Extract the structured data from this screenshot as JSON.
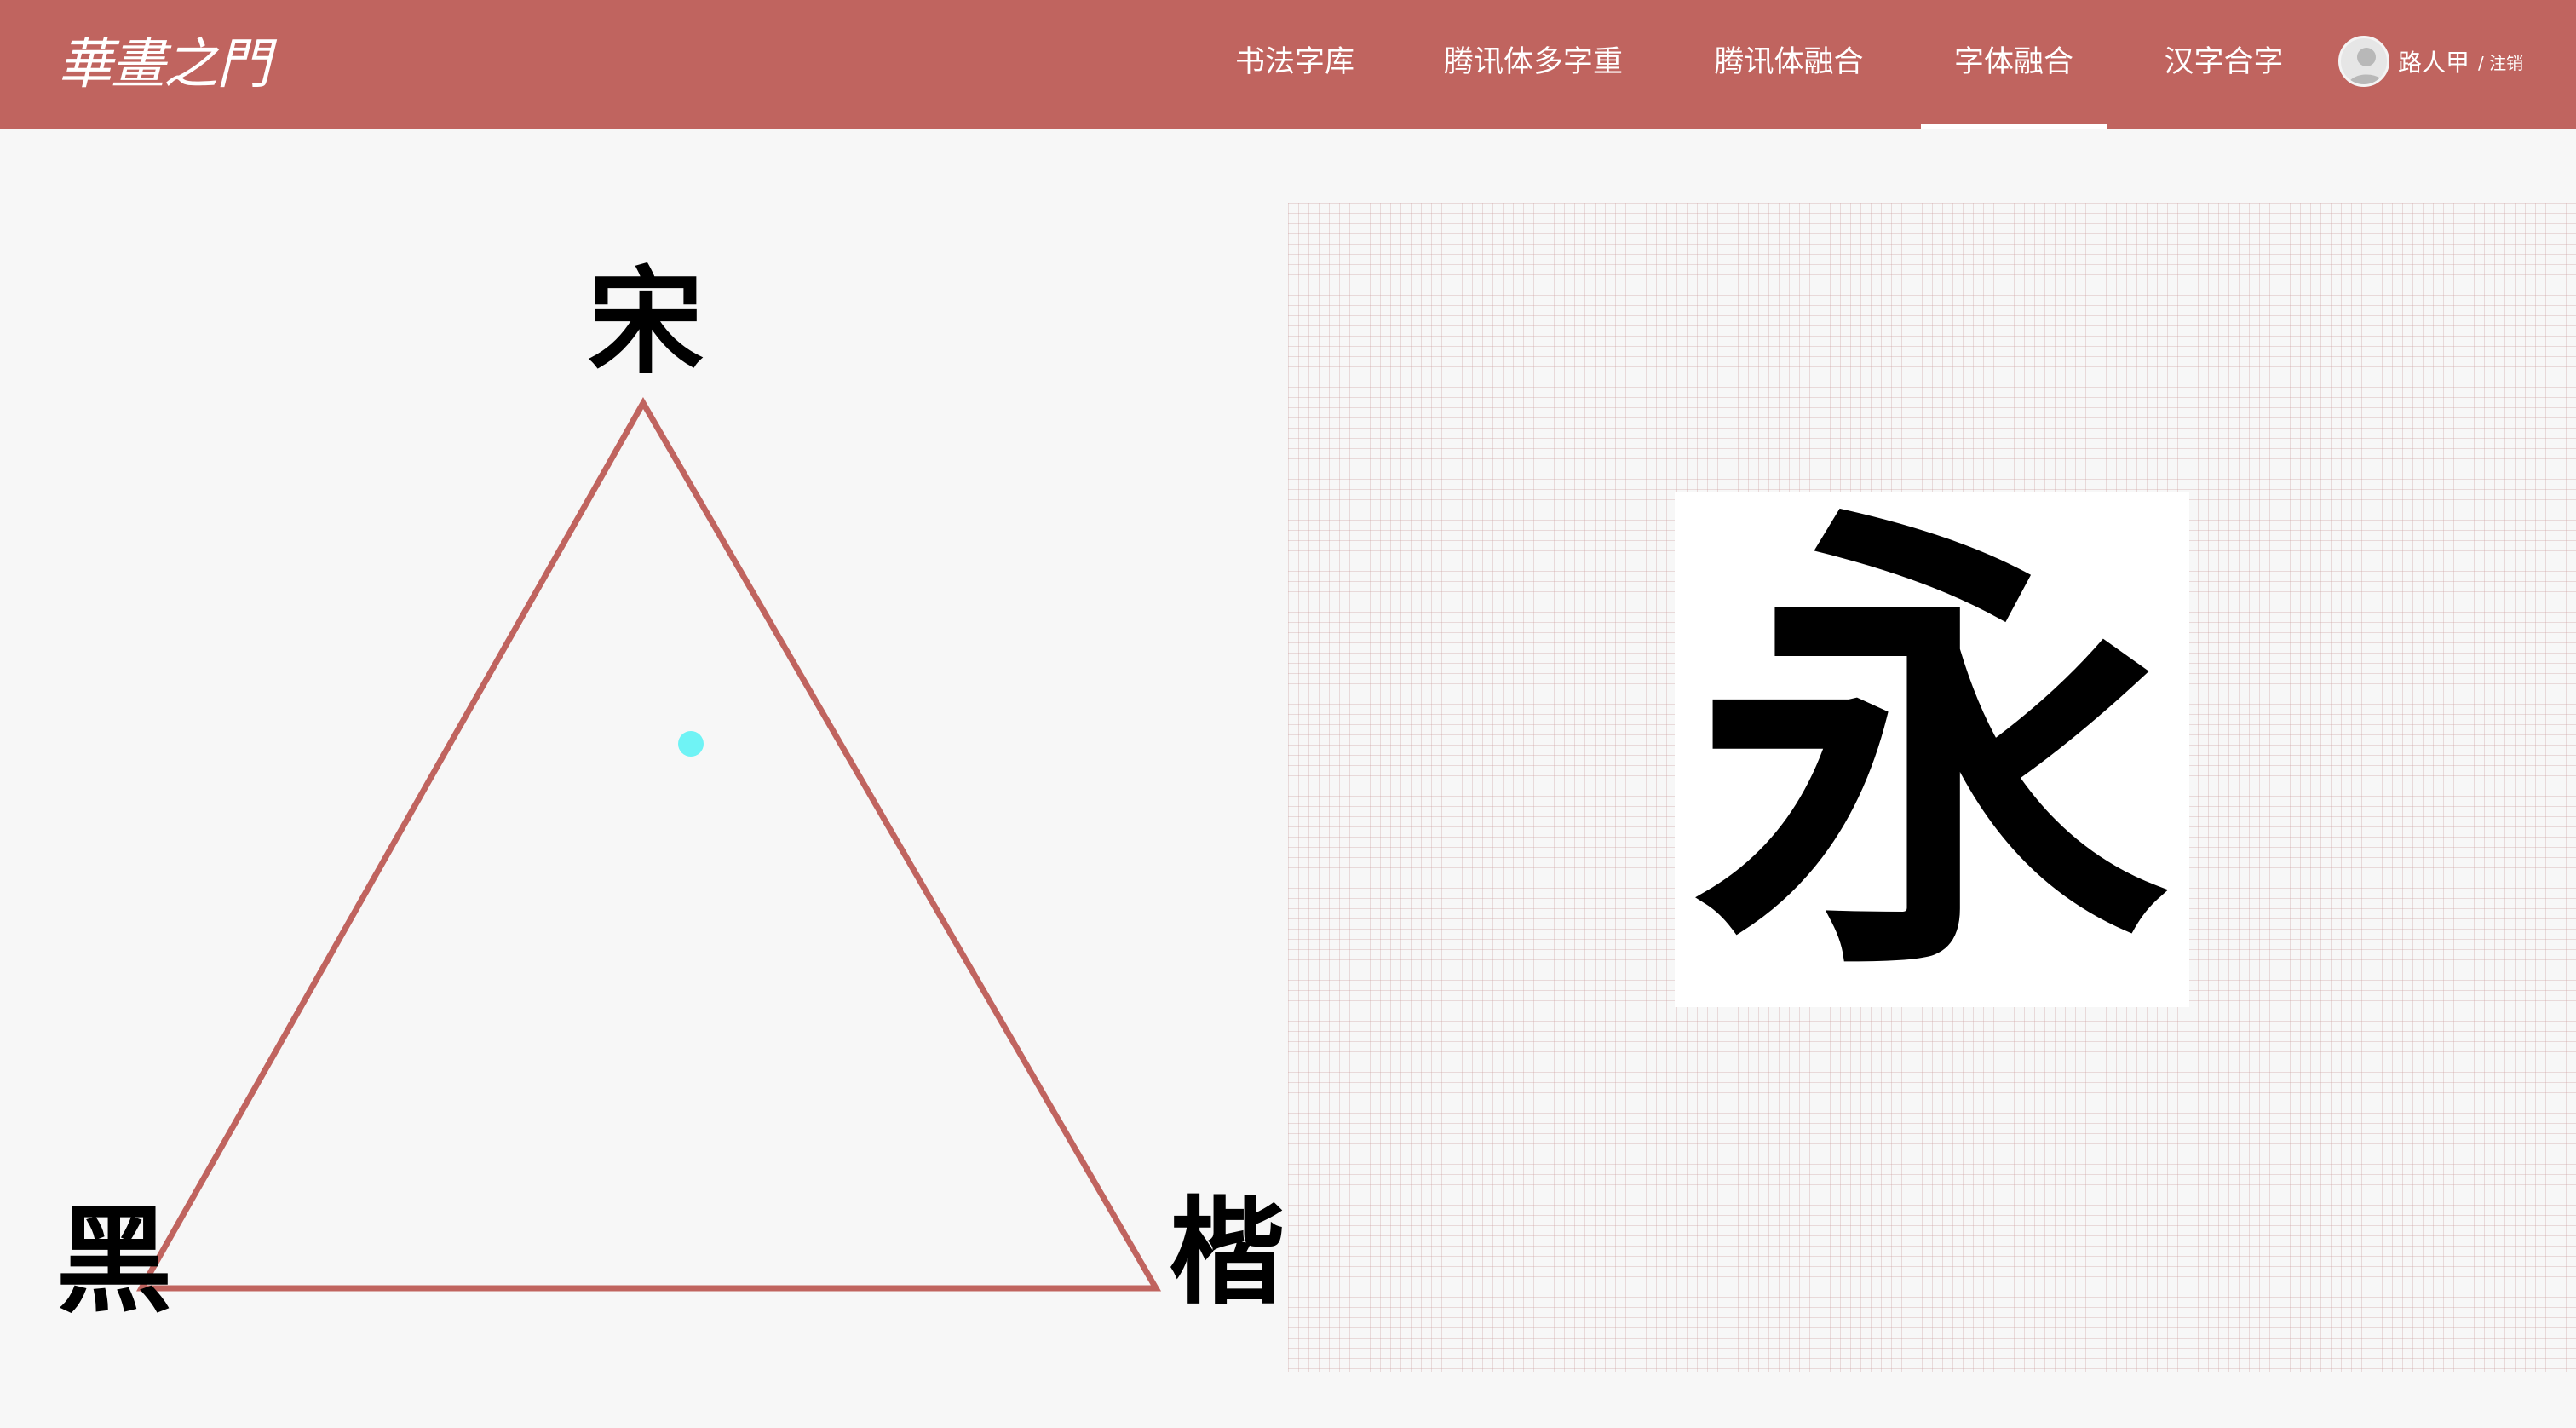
{
  "header": {
    "logo": "華畫之門",
    "nav": [
      {
        "label": "书法字库",
        "active": false
      },
      {
        "label": "腾讯体多字重",
        "active": false
      },
      {
        "label": "腾讯体融合",
        "active": false
      },
      {
        "label": "字体融合",
        "active": true
      },
      {
        "label": "汉字合字",
        "active": false
      }
    ],
    "user": {
      "name": "路人甲",
      "logout": "/ 注销"
    }
  },
  "colors": {
    "header_bg": "#c0645f",
    "triangle_stroke": "#c0645f",
    "handle": "#6ff3f5",
    "page_bg": "#f7f7f7"
  },
  "fusion": {
    "vertices": {
      "top": "宋",
      "bottom_left": "黑",
      "bottom_right": "楷"
    },
    "preview_char": "永"
  }
}
